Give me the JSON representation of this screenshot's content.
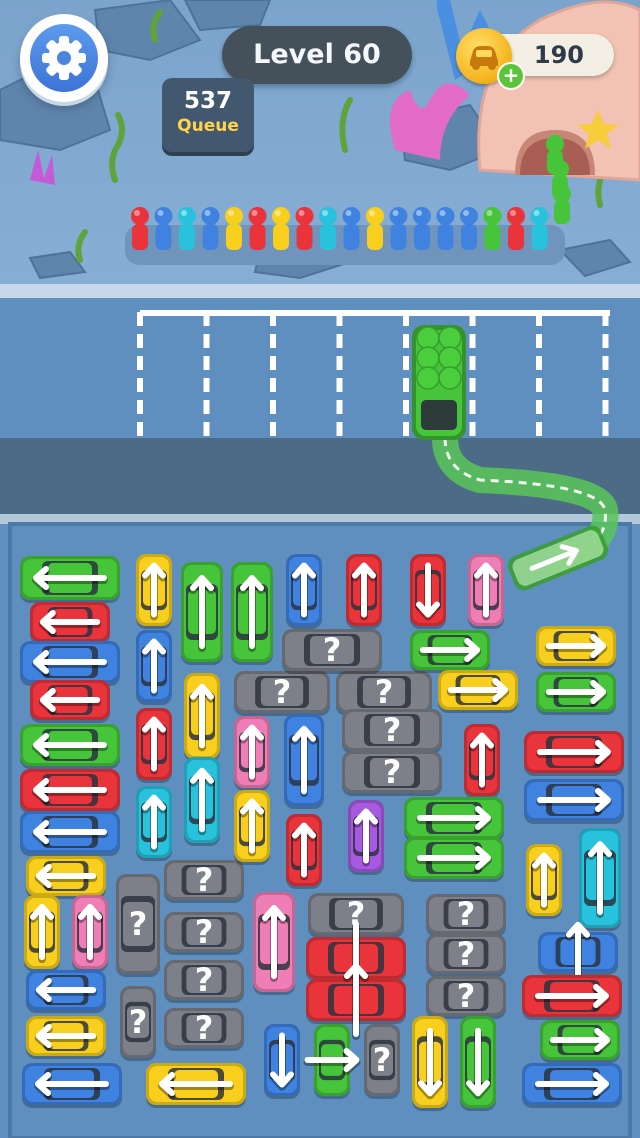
{
  "hud": {
    "settings_icon": "gear-icon",
    "level_label": "Level 60",
    "coins": "190",
    "coin_icon": "car-coin-icon",
    "coin_add_icon": "plus-icon",
    "coin_add_symbol": "+",
    "queue_count": "537",
    "queue_label": "Queue"
  },
  "queue_colors": [
    "red",
    "blue",
    "cyan",
    "blue",
    "yellow",
    "red",
    "yellow",
    "red",
    "cyan",
    "blue",
    "yellow",
    "blue",
    "blue",
    "blue",
    "blue",
    "green",
    "red",
    "cyan"
  ],
  "parking_slots": {
    "total": 7,
    "occupied": [
      {
        "slot": 5,
        "color": "green",
        "passengers": "full"
      }
    ]
  },
  "exiting_car": {
    "color": "green",
    "type": "van",
    "direction": "up-right"
  },
  "colors": {
    "red": "#e8343a",
    "blue": "#3f82e0",
    "cyan": "#28c2dc",
    "yellow": "#f7cf1c",
    "green": "#46c43a",
    "pink": "#f07eb6",
    "purple": "#a75ae0",
    "gray": "#7d8088",
    "ground": "#7ea6cf",
    "road": "#4c6b86",
    "lot": "#5e8fbf"
  },
  "cars": [
    {
      "color": "green",
      "dir": "left",
      "size": "long"
    },
    {
      "color": "red",
      "dir": "left",
      "size": "short"
    },
    {
      "color": "blue",
      "dir": "left",
      "size": "long"
    },
    {
      "color": "red",
      "dir": "left",
      "size": "short"
    },
    {
      "color": "green",
      "dir": "left",
      "size": "long"
    },
    {
      "color": "red",
      "dir": "left",
      "size": "long"
    },
    {
      "color": "blue",
      "dir": "left",
      "size": "long"
    },
    {
      "color": "yellow",
      "dir": "left",
      "size": "short"
    },
    {
      "color": "yellow",
      "dir": "up",
      "size": "short"
    },
    {
      "color": "pink",
      "dir": "up",
      "size": "short"
    },
    {
      "color": "blue",
      "dir": "left",
      "size": "short"
    },
    {
      "color": "yellow",
      "dir": "left",
      "size": "short"
    },
    {
      "color": "blue",
      "dir": "left",
      "size": "long"
    },
    {
      "color": "yellow",
      "dir": "up",
      "size": "short"
    },
    {
      "color": "blue",
      "dir": "up",
      "size": "short"
    },
    {
      "color": "red",
      "dir": "up",
      "size": "short"
    },
    {
      "color": "cyan",
      "dir": "up",
      "size": "short"
    },
    {
      "color": "gray",
      "dir": "unknown",
      "size": "long"
    },
    {
      "color": "gray",
      "dir": "unknown",
      "size": "short"
    },
    {
      "color": "green",
      "dir": "up",
      "size": "long"
    },
    {
      "color": "yellow",
      "dir": "up",
      "size": "short"
    },
    {
      "color": "cyan",
      "dir": "up",
      "size": "short"
    },
    {
      "color": "gray",
      "dir": "unknown",
      "size": "short"
    },
    {
      "color": "gray",
      "dir": "unknown",
      "size": "short"
    },
    {
      "color": "gray",
      "dir": "unknown",
      "size": "short"
    },
    {
      "color": "gray",
      "dir": "unknown",
      "size": "short"
    },
    {
      "color": "yellow",
      "dir": "left",
      "size": "long"
    },
    {
      "color": "green",
      "dir": "up",
      "size": "long"
    },
    {
      "color": "pink",
      "dir": "up",
      "size": "short"
    },
    {
      "color": "yellow",
      "dir": "up",
      "size": "short"
    },
    {
      "color": "pink",
      "dir": "up",
      "size": "long"
    },
    {
      "color": "gray",
      "dir": "unknown",
      "size": "long"
    },
    {
      "color": "blue",
      "dir": "up",
      "size": "short"
    },
    {
      "color": "blue",
      "dir": "up",
      "size": "short"
    },
    {
      "color": "red",
      "dir": "up",
      "size": "short"
    },
    {
      "color": "blue",
      "dir": "down",
      "size": "short"
    },
    {
      "color": "gray",
      "dir": "unknown",
      "size": "long"
    },
    {
      "color": "gray",
      "dir": "unknown",
      "size": "long"
    },
    {
      "color": "gray",
      "dir": "unknown",
      "size": "long"
    },
    {
      "color": "gray",
      "dir": "unknown",
      "size": "long"
    },
    {
      "color": "red",
      "dir": "down",
      "size": "short"
    },
    {
      "color": "red",
      "dir": "up",
      "size": "short"
    },
    {
      "color": "green",
      "dir": "right",
      "size": "long"
    },
    {
      "color": "gray",
      "dir": "unknown",
      "size": "long"
    },
    {
      "color": "gray",
      "dir": "unknown",
      "size": "long"
    },
    {
      "color": "red",
      "dir": "up",
      "size": "short"
    },
    {
      "color": "purple",
      "dir": "up",
      "size": "short"
    },
    {
      "color": "red",
      "dir": "down",
      "size": "short"
    },
    {
      "color": "red",
      "dir": "up",
      "size": "short"
    },
    {
      "color": "green",
      "dir": "right",
      "size": "short"
    },
    {
      "color": "yellow",
      "dir": "right",
      "size": "short"
    },
    {
      "color": "pink",
      "dir": "up",
      "size": "short"
    },
    {
      "color": "green",
      "dir": "right",
      "size": "long"
    },
    {
      "color": "green",
      "dir": "right",
      "size": "long"
    },
    {
      "color": "gray",
      "dir": "unknown",
      "size": "short"
    },
    {
      "color": "gray",
      "dir": "unknown",
      "size": "short"
    },
    {
      "color": "gray",
      "dir": "unknown",
      "size": "short"
    },
    {
      "color": "yellow",
      "dir": "down",
      "size": "short"
    },
    {
      "color": "green",
      "dir": "down",
      "size": "short"
    },
    {
      "color": "yellow",
      "dir": "up",
      "size": "short"
    },
    {
      "color": "yellow",
      "dir": "right",
      "size": "short"
    },
    {
      "color": "green",
      "dir": "right",
      "size": "short"
    },
    {
      "color": "red",
      "dir": "right",
      "size": "long"
    },
    {
      "color": "blue",
      "dir": "right",
      "size": "long"
    },
    {
      "color": "cyan",
      "dir": "up",
      "size": "short"
    },
    {
      "color": "blue",
      "dir": "up",
      "size": "long"
    },
    {
      "color": "red",
      "dir": "right",
      "size": "short"
    },
    {
      "color": "green",
      "dir": "right",
      "size": "long"
    },
    {
      "color": "blue",
      "dir": "right",
      "size": "short"
    },
    {
      "color": "yellow",
      "dir": "right",
      "size": "long"
    }
  ]
}
